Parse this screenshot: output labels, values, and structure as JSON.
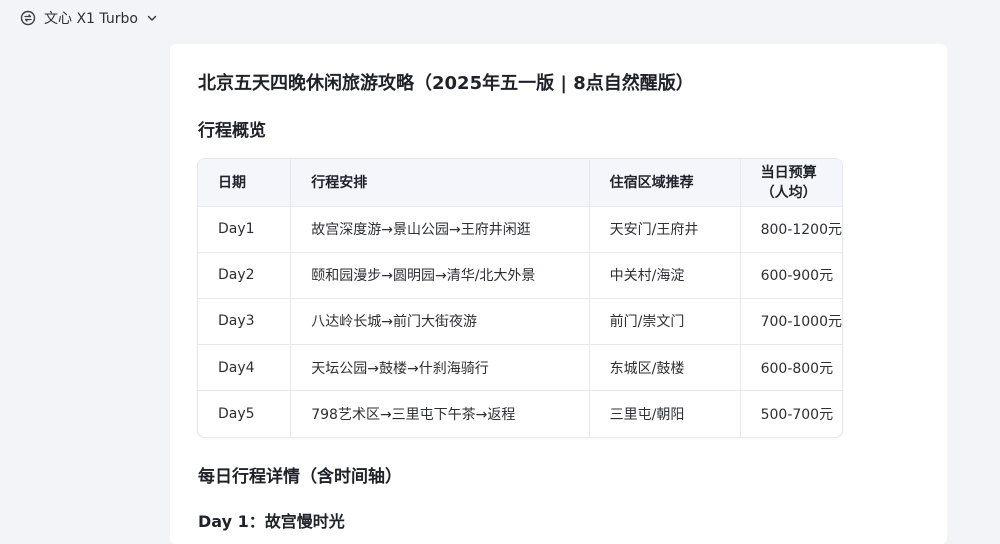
{
  "app": {
    "model_name": "文心 X1 Turbo",
    "model_icon": "model-switch-icon",
    "dropdown_icon": "chevron-down-icon"
  },
  "document": {
    "title": "北京五天四晚休闲旅游攻略（2025年五一版 | 8点自然醒版）",
    "section_overview": "行程概览",
    "section_details": "每日行程详情（含时间轴）",
    "subsection_day1": "Day 1：故宫慢时光"
  },
  "table": {
    "headers": [
      "日期",
      "行程安排",
      "住宿区域推荐",
      "当日预算（人均）"
    ],
    "rows": [
      [
        "Day1",
        "故宫深度游→景山公园→王府井闲逛",
        "天安门/王府井",
        "800-1200元"
      ],
      [
        "Day2",
        "颐和园漫步→圆明园→清华/北大外景",
        "中关村/海淀",
        "600-900元"
      ],
      [
        "Day3",
        "八达岭长城→前门大街夜游",
        "前门/崇文门",
        "700-1000元"
      ],
      [
        "Day4",
        "天坛公园→鼓楼→什刹海骑行",
        "东城区/鼓楼",
        "600-800元"
      ],
      [
        "Day5",
        "798艺术区→三里屯下午茶→返程",
        "三里屯/朝阳",
        "500-700元"
      ]
    ]
  },
  "colors": {
    "page_bg": "#f3f4f8",
    "card_bg": "#ffffff",
    "table_header_bg": "#f4f6fb",
    "border": "#e6e8ee",
    "text": "#1f2329"
  }
}
